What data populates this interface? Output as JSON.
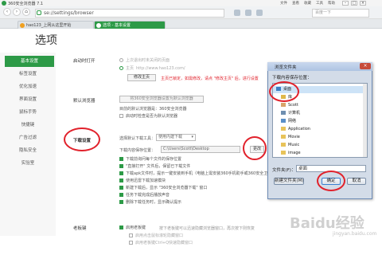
{
  "browser": {
    "title": "360安全浏览器 7.1",
    "window_menu": [
      "文件",
      "查看",
      "收藏",
      "工具",
      "帮助"
    ],
    "url": "se://settings/browser",
    "search_placeholder": "百度一下",
    "tabs": [
      {
        "label": "hao123_上网从这里开始"
      },
      {
        "label": "选项 - 基本设置"
      }
    ]
  },
  "page": {
    "title": "选项",
    "sidebar": [
      "基本设置",
      "标签设置",
      "优化加速",
      "界面设置",
      "鼠标手势",
      "快捷键",
      "广告过滤",
      "隐私安全",
      "实验室"
    ],
    "startup": {
      "label": "启动时打开",
      "opt1": "上次退出时未关闭的页面",
      "opt2": "主页",
      "home_url": "http://www.hao123.com/",
      "modify_btn": "修改主页",
      "home_note": "主页已锁定，如需修改，请点 \"修改主页\" 后，进行设置"
    },
    "default_browser": {
      "label": "默认浏览器",
      "btn": "将360安全浏览器设置为默认浏览器",
      "note": "目前的默认浏览器是：360安全浏览器",
      "check": "启动时检查是否为默认浏览器"
    },
    "download": {
      "label": "下载设置",
      "tool_label": "选择默认下载工具：",
      "tool_value": "使用内建下载",
      "path_label": "下载内容保存位置：",
      "path_value": "C:\\Users\\Scott\\Desktop",
      "change_btn": "更改",
      "options": [
        "下载前询问每个文件的保存位置",
        "\"直接打开\" 文件后，保留已下载文件",
        "下载apk文件时，提示一键安装到手机（电脑上需安装360手机助手或360安全卫士）",
        "使用迅雷下载加速模块",
        "新建下载后，显示 \"360安全浏览器下载\" 窗口",
        "任务下载完成后播放声音",
        "删除下载任务时，显示确认提示"
      ]
    },
    "boss_key": {
      "label": "老板键",
      "check": "启用老板键",
      "note": "按下老板键可以迅速隐藏浏览器窗口，再次按下则恢复",
      "sub1": "启用点击鼠标滚轮隐藏窗口",
      "sub2": "启用老板键Ctrl+Q快速隐藏窗口"
    }
  },
  "dialog": {
    "title": "浏览文件夹",
    "prompt": "下载内容保存位置：",
    "tree": [
      "桌面",
      "库",
      "Scott",
      "计算机",
      "网络",
      "Application",
      "Movie",
      "Music",
      "image"
    ],
    "folder_label": "文件夹(F)：",
    "folder_value": "桌面",
    "new_folder_btn": "新建文件夹(M)",
    "ok_btn": "确定",
    "cancel_btn": "取消"
  },
  "watermark": {
    "main": "Baidu经验",
    "sub": "jingyan.baidu.com"
  },
  "colors": {
    "accent": "#2d9a47",
    "annotation": "#e1212b"
  }
}
